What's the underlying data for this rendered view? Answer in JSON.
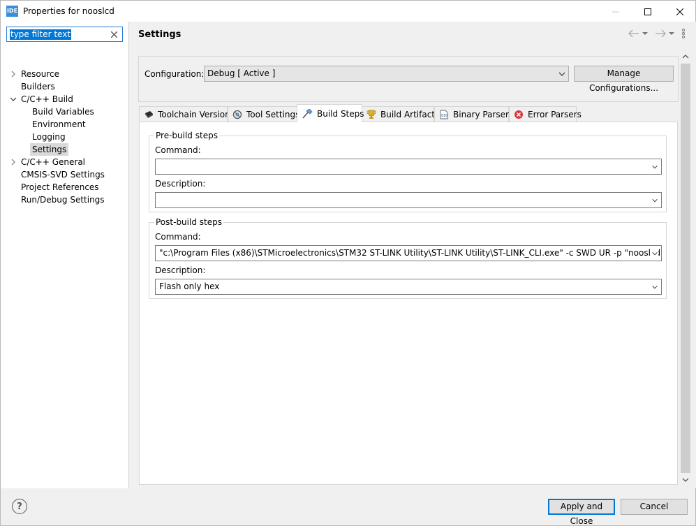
{
  "window": {
    "title": "Properties for nooslcd",
    "app_icon_text": "IDE"
  },
  "filter": {
    "value": "type filter text"
  },
  "tree": {
    "items": [
      {
        "label": "Resource"
      },
      {
        "label": "Builders"
      },
      {
        "label": "C/C++ Build"
      },
      {
        "label": "Build Variables"
      },
      {
        "label": "Environment"
      },
      {
        "label": "Logging"
      },
      {
        "label": "Settings"
      },
      {
        "label": "C/C++ General"
      },
      {
        "label": "CMSIS-SVD Settings"
      },
      {
        "label": "Project References"
      },
      {
        "label": "Run/Debug Settings"
      }
    ],
    "selected": "Settings"
  },
  "header": {
    "title": "Settings"
  },
  "configuration": {
    "label": "Configuration:",
    "value": "Debug  [ Active ]",
    "manage_label": "Manage Configurations..."
  },
  "tabs": [
    {
      "label": "Toolchain Version",
      "icon": "chip-icon"
    },
    {
      "label": "Tool Settings",
      "icon": "gear-icon"
    },
    {
      "label": "Build Steps",
      "icon": "hammer-icon"
    },
    {
      "label": "Build Artifact",
      "icon": "trophy-icon"
    },
    {
      "label": "Binary Parsers",
      "icon": "binary-file-icon"
    },
    {
      "label": "Error Parsers",
      "icon": "error-icon"
    }
  ],
  "active_tab": "Build Steps",
  "pre_build": {
    "title": "Pre-build steps",
    "command_label": "Command:",
    "command_value": "",
    "description_label": "Description:",
    "description_value": ""
  },
  "post_build": {
    "title": "Post-build steps",
    "command_label": "Command:",
    "command_value": "\"c:\\Program Files (x86)\\STMicroelectronics\\STM32 ST-LINK Utility\\ST-LINK Utility\\ST-LINK_CLI.exe\"  -c SWD UR -p \"nooslcd.hex\" -V",
    "description_label": "Description:",
    "description_value": "Flash only hex"
  },
  "buttons": {
    "help": "?",
    "apply_close": "Apply and Close",
    "cancel": "Cancel"
  },
  "colors": {
    "accent": "#0078d7",
    "selection_bg": "#d9d9d9"
  }
}
